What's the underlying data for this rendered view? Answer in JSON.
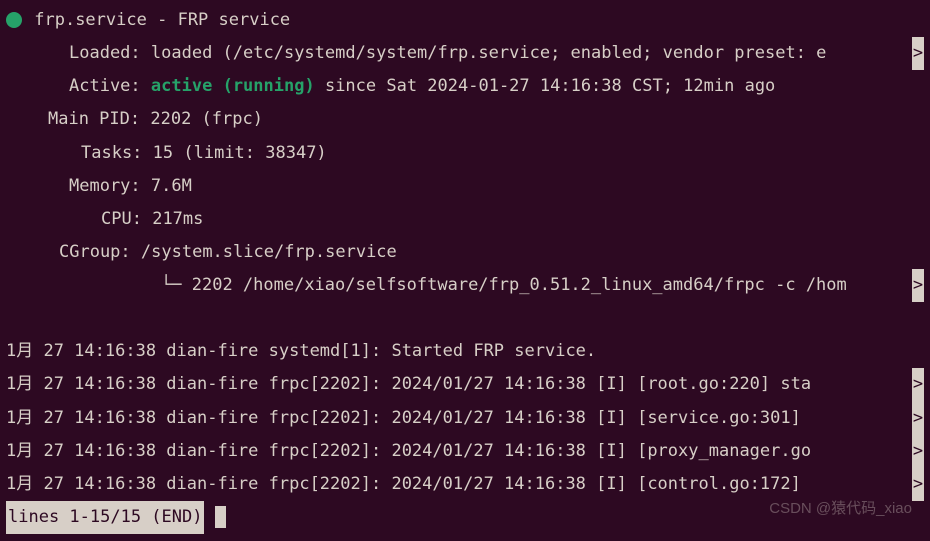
{
  "service": {
    "name": "frp.service",
    "description": "FRP service",
    "loaded_label": "Loaded:",
    "loaded_value": "loaded (/etc/systemd/system/frp.service; enabled; vendor preset: e",
    "active_label": "Active:",
    "active_status": "active",
    "active_running": "(running)",
    "active_since": "since Sat 2024-01-27 14:16:38 CST; 12min ago",
    "mainpid_label": "Main PID:",
    "mainpid_value": "2202 (frpc)",
    "tasks_label": "Tasks:",
    "tasks_value": "15 (limit: 38347)",
    "memory_label": "Memory:",
    "memory_value": "7.6M",
    "cpu_label": "CPU:",
    "cpu_value": "217ms",
    "cgroup_label": "CGroup:",
    "cgroup_value": "/system.slice/frp.service",
    "cgroup_tree_prefix": "└─",
    "cgroup_process": "2202 /home/xiao/selfsoftware/frp_0.51.2_linux_amd64/frpc -c /hom"
  },
  "logs": [
    "1月 27 14:16:38 dian-fire systemd[1]: Started FRP service.",
    "1月 27 14:16:38 dian-fire frpc[2202]: 2024/01/27 14:16:38 [I] [root.go:220] sta",
    "1月 27 14:16:38 dian-fire frpc[2202]: 2024/01/27 14:16:38 [I] [service.go:301] ",
    "1月 27 14:16:38 dian-fire frpc[2202]: 2024/01/27 14:16:38 [I] [proxy_manager.go",
    "1月 27 14:16:38 dian-fire frpc[2202]: 2024/01/27 14:16:38 [I] [control.go:172] "
  ],
  "overflow_char": ">",
  "status_line": "lines 1-15/15 (END)",
  "watermark": "CSDN @猿代码_xiao"
}
